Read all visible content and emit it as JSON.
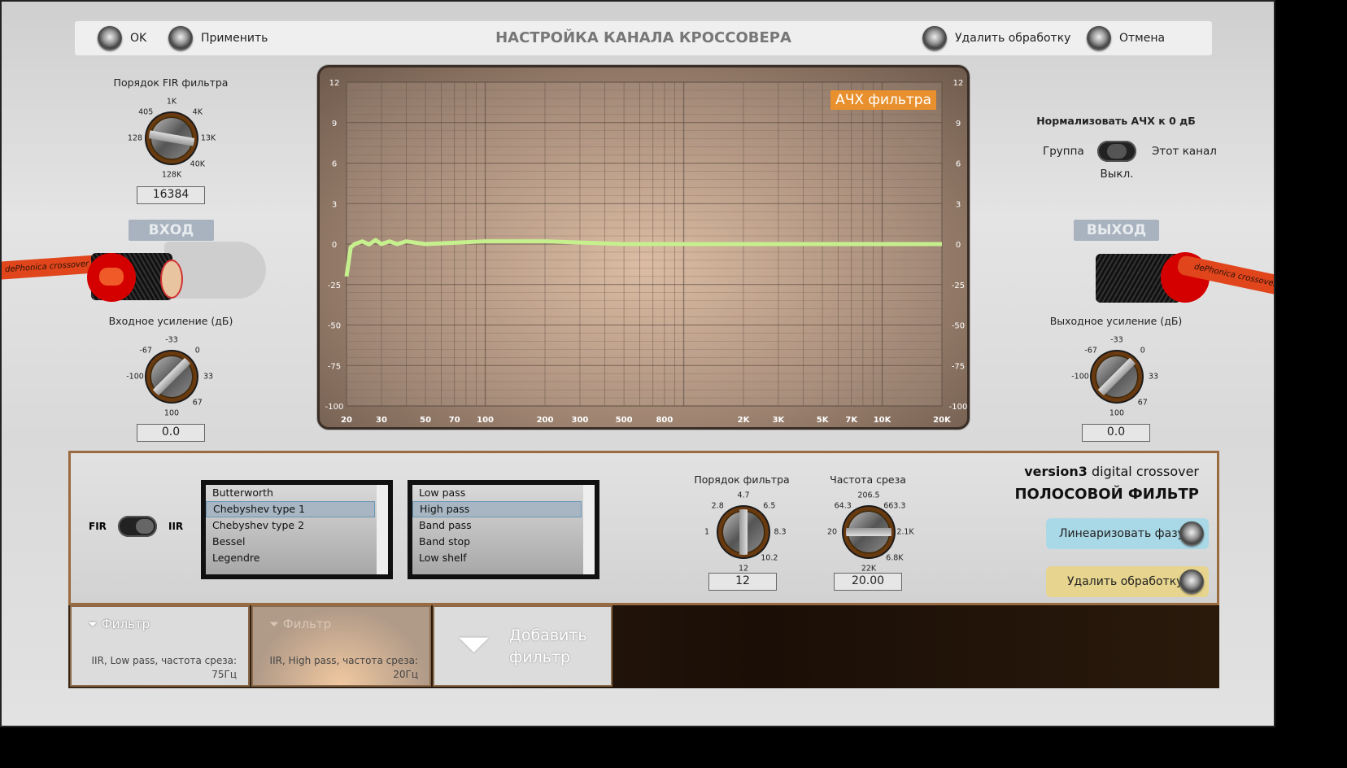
{
  "header": {
    "title": "НАСТРОЙКА КАНАЛА КРОССОВЕРА",
    "ok": "OK",
    "apply": "Применить",
    "remove": "Удалить обработку",
    "cancel": "Отмена"
  },
  "left": {
    "fir_label": "Порядок FIR фильтра",
    "fir_ticks": [
      "128",
      "405",
      "1K",
      "4K",
      "13K",
      "40K",
      "128K"
    ],
    "fir_value": "16384",
    "input_label": "ВХОД",
    "gain_label": "Входное усиление (дБ)",
    "gain_ticks": [
      "-100",
      "-67",
      "-33",
      "0",
      "33",
      "67",
      "100"
    ],
    "gain_value": "0.0",
    "cable_text": "dePhonica crossover"
  },
  "right": {
    "normalize_label": "Нормализовать АЧХ к 0 дБ",
    "group": "Группа",
    "this_channel": "Этот канал",
    "toggle_state": "Выкл.",
    "output_label": "ВЫХОД",
    "gain_label": "Выходное усиление (дБ)",
    "gain_ticks": [
      "-100",
      "-67",
      "-33",
      "0",
      "33",
      "67",
      "100"
    ],
    "gain_value": "0.0",
    "cable_text": "dePhonica crossover"
  },
  "chart_data": {
    "type": "line",
    "title": "АЧХ фильтра",
    "x_scale": "log",
    "xlim": [
      20,
      20000
    ],
    "x_ticks": [
      "20",
      "30",
      "50",
      "70",
      "100",
      "200",
      "300",
      "500",
      "800",
      "2K",
      "3K",
      "5K",
      "7K",
      "10K",
      "20K"
    ],
    "x_tick_values": [
      20,
      30,
      50,
      70,
      100,
      200,
      300,
      500,
      800,
      2000,
      3000,
      5000,
      7000,
      10000,
      20000
    ],
    "y_ticks": [
      "12",
      "9",
      "6",
      "3",
      "0",
      "-25",
      "-50",
      "-75",
      "-100"
    ],
    "grid": true,
    "line_color": "#c6ef8e",
    "series": [
      {
        "x": [
          20,
          21,
          22,
          24,
          26,
          28,
          30,
          33,
          36,
          40,
          50,
          70,
          100,
          200,
          500,
          1000,
          5000,
          20000
        ],
        "y": [
          -20,
          -2,
          0,
          0.2,
          -0.2,
          0.3,
          0,
          0.2,
          0,
          0.2,
          0,
          0.1,
          0.2,
          0.2,
          0,
          0,
          0,
          0
        ]
      }
    ]
  },
  "bottom": {
    "fir": "FIR",
    "iir": "IIR",
    "types": [
      "Butterworth",
      "Chebyshev type 1",
      "Chebyshev type 2",
      "Bessel",
      "Legendre"
    ],
    "selected_type": 1,
    "modes": [
      "Low pass",
      "High pass",
      "Band pass",
      "Band stop",
      "Low shelf"
    ],
    "selected_mode": 1,
    "order_label": "Порядок фильтра",
    "order_ticks": [
      "1",
      "2.8",
      "4.7",
      "6.5",
      "8.3",
      "10.2",
      "12"
    ],
    "order_value": "12",
    "freq_label": "Частота среза",
    "freq_ticks": [
      "20",
      "64.3",
      "206.5",
      "663.3",
      "2.1K",
      "6.8K",
      "22K"
    ],
    "freq_value": "20.00",
    "brand_bold": "version3",
    "brand_rest": " digital crossover",
    "section_title": "ПОЛОСОВОЙ ФИЛЬТР",
    "linearize": "Линеаризовать фазу",
    "remove": "Удалить обработку"
  },
  "filters": [
    {
      "title": "Фильтр",
      "desc": "IIR, Low pass, частота среза:",
      "freq": "75Гц"
    },
    {
      "title": "Фильтр",
      "desc": "IIR, High pass, частота среза:",
      "freq": "20Гц"
    }
  ],
  "add_filter": "Добавить фильтр"
}
